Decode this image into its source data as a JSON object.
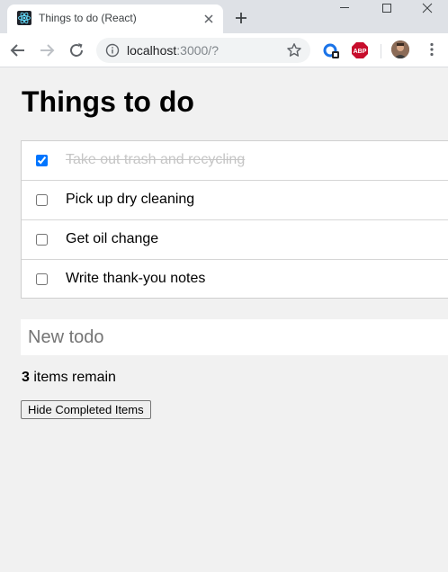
{
  "browser": {
    "tab": {
      "title": "Things to do (React)",
      "favicon": "react-logo-icon"
    },
    "address": {
      "host": "localhost",
      "path": ":3000/?"
    },
    "icons": {
      "back": "arrow-left-icon",
      "forward": "arrow-right-icon",
      "reload": "reload-icon",
      "info": "info-icon",
      "bookmark": "star-icon",
      "extension": "extension-icon",
      "adblock": "abp-icon",
      "menu": "kebab-menu-icon"
    },
    "abp_label": "ABP"
  },
  "app": {
    "title": "Things to do",
    "todos": [
      {
        "text": "Take out trash and recycling",
        "done": true
      },
      {
        "text": "Pick up dry cleaning",
        "done": false
      },
      {
        "text": "Get oil change",
        "done": false
      },
      {
        "text": "Write thank-you notes",
        "done": false
      }
    ],
    "new_todo_placeholder": "New todo",
    "new_todo_value": "",
    "remaining_count": "3",
    "remaining_suffix": " items remain",
    "hide_button_label": "Hide Completed Items"
  },
  "colors": {
    "page_background": "#f1f1f1",
    "completed_text": "#c5c5c5",
    "tabstrip": "#dee1e6"
  }
}
